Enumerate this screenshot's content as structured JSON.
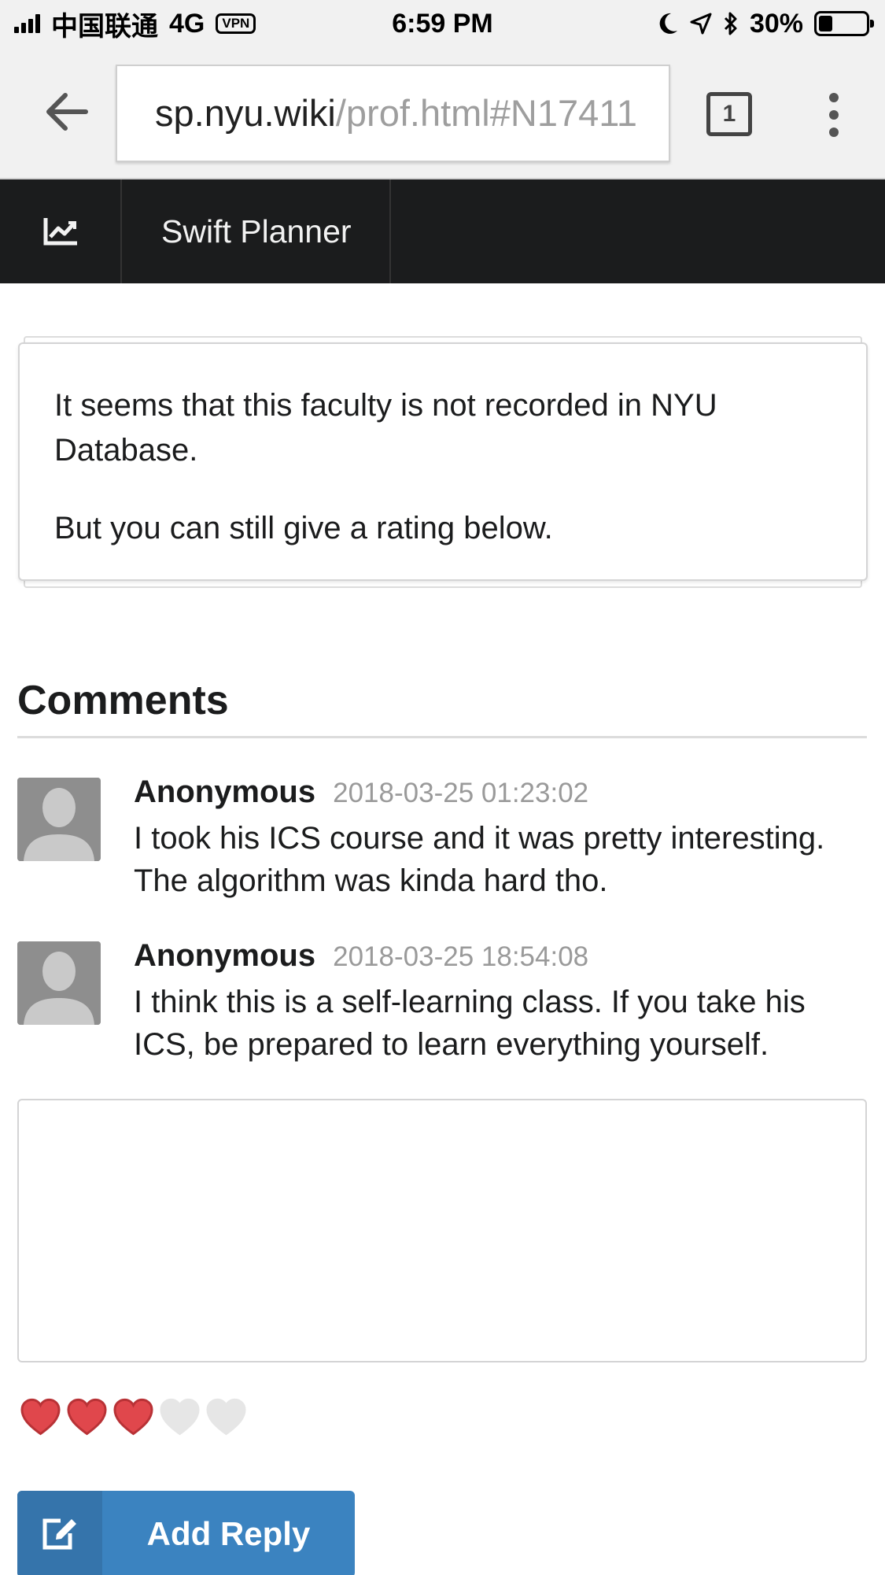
{
  "status_bar": {
    "carrier": "中国联通",
    "network": "4G",
    "vpn_label": "VPN",
    "time": "6:59 PM",
    "battery_percent": "30%",
    "battery_level": 0.3
  },
  "browser": {
    "url_domain": "sp.nyu.wiki",
    "url_path": "/prof.html#N17411",
    "tab_count": "1"
  },
  "nav": {
    "logo_icon": "chart-line-icon",
    "title": "Swift Planner"
  },
  "notice": {
    "line1": "It seems that this faculty is not recorded in NYU Database.",
    "line2": "But you can still give a rating below."
  },
  "comments": {
    "header": "Comments",
    "items": [
      {
        "author": "Anonymous",
        "date": "2018-03-25 01:23:02",
        "text": "I took his ICS course and it was pretty interesting. The algorithm was kinda hard tho."
      },
      {
        "author": "Anonymous",
        "date": "2018-03-25 18:54:08",
        "text": "I think this is a self-learning class. If you take his ICS, be prepared to learn everything yourself."
      }
    ]
  },
  "reply": {
    "textarea_value": "",
    "rating": 3,
    "rating_max": 5,
    "button_label": "Add Reply"
  },
  "colors": {
    "heart_active": "#e0474c",
    "heart_inactive": "#e6e6e6",
    "button_blue": "#3b83c0",
    "nav_dark": "#1b1c1d"
  }
}
